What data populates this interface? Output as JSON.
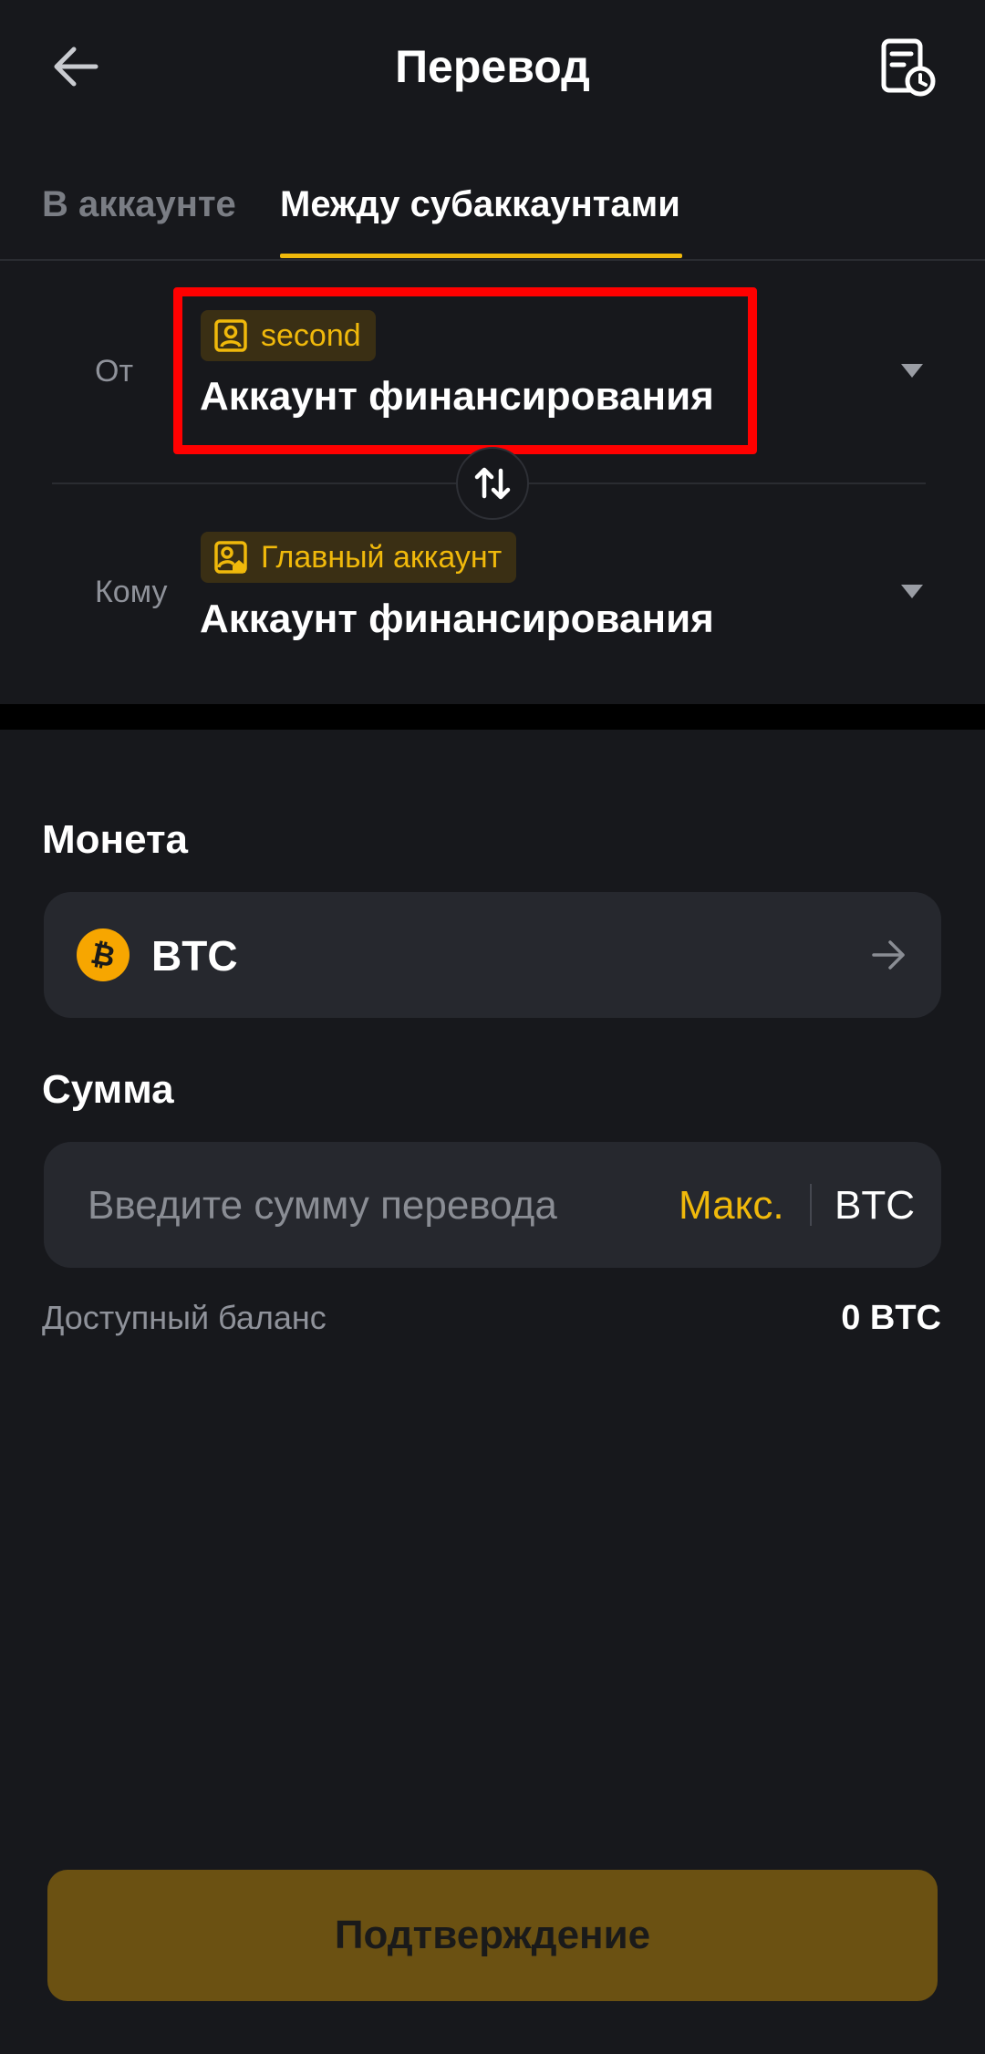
{
  "header": {
    "title": "Перевод",
    "back_icon": "arrow-left-icon",
    "history_icon": "history-document-clock-icon"
  },
  "tabs": [
    {
      "label": "В аккаунте",
      "active": false
    },
    {
      "label": "Между субаккаунтами",
      "active": true
    }
  ],
  "transfer": {
    "from": {
      "label": "От",
      "badge": "second",
      "badge_icon": "user-icon",
      "account": "Аккаунт финансирования",
      "highlighted": true
    },
    "to": {
      "label": "Кому",
      "badge": "Главный аккаунт",
      "badge_icon": "main-account-icon",
      "account": "Аккаунт финансирования"
    },
    "swap_icon": "swap-arrows-icon"
  },
  "coin": {
    "section_title": "Монета",
    "name": "BTC",
    "icon": "bitcoin-icon"
  },
  "amount": {
    "section_title": "Сумма",
    "placeholder": "Введите сумму перевода",
    "max_label": "Макс.",
    "unit": "BTC"
  },
  "balance": {
    "label": "Доступный баланс",
    "value": "0 BTC"
  },
  "confirm_label": "Подтверждение",
  "colors": {
    "accent": "#f0b90b",
    "background": "#17181c",
    "field": "#26282e",
    "highlight": "#ff0000",
    "confirm_disabled": "#6b5112"
  }
}
